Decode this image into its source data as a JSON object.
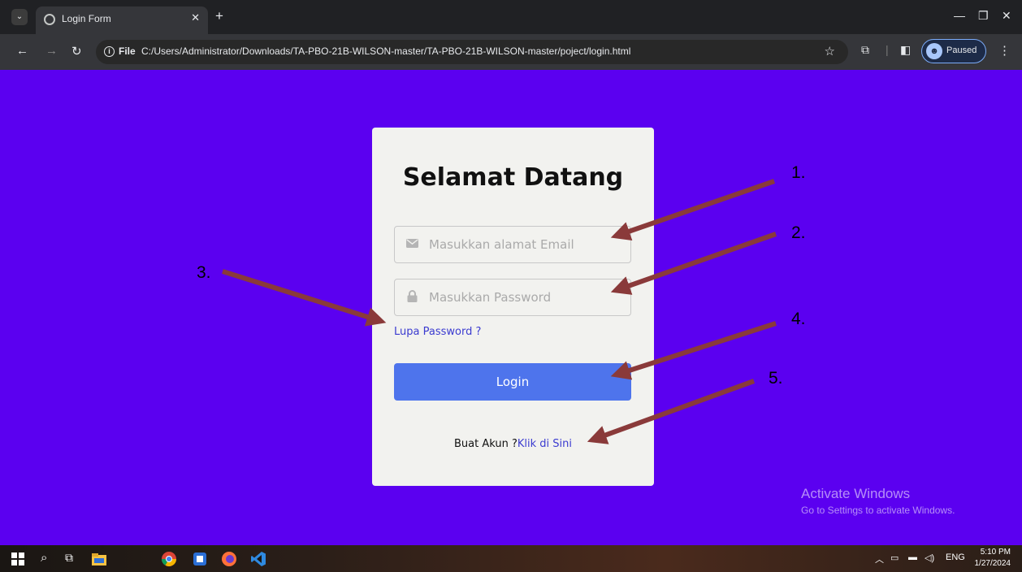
{
  "browser": {
    "tab_title": "Login Form",
    "url_chip": "File",
    "url": "C:/Users/Administrator/Downloads/TA-PBO-21B-WILSON-master/TA-PBO-21B-WILSON-master/poject/login.html",
    "profile_status": "Paused"
  },
  "form": {
    "title": "Selamat Datang",
    "email_placeholder": "Masukkan alamat Email",
    "password_placeholder": "Masukkan Password",
    "forgot_link": "Lupa Password ?",
    "login_button": "Login",
    "signup_prompt": "Buat Akun ?",
    "signup_link": "Klik di Sini"
  },
  "annotations": [
    "1.",
    "2.",
    "3.",
    "4.",
    "5."
  ],
  "watermark": {
    "title": "Activate Windows",
    "subtitle": "Go to Settings to activate Windows."
  },
  "taskbar": {
    "language": "ENG",
    "time": "5:10 PM",
    "date": "1/27/2024"
  },
  "colors": {
    "page_background": "#5b00f0",
    "card": "#f2f2ef",
    "login_button": "#4e74ec",
    "link": "#3b3bd0",
    "arrow": "#8a3a3a"
  }
}
